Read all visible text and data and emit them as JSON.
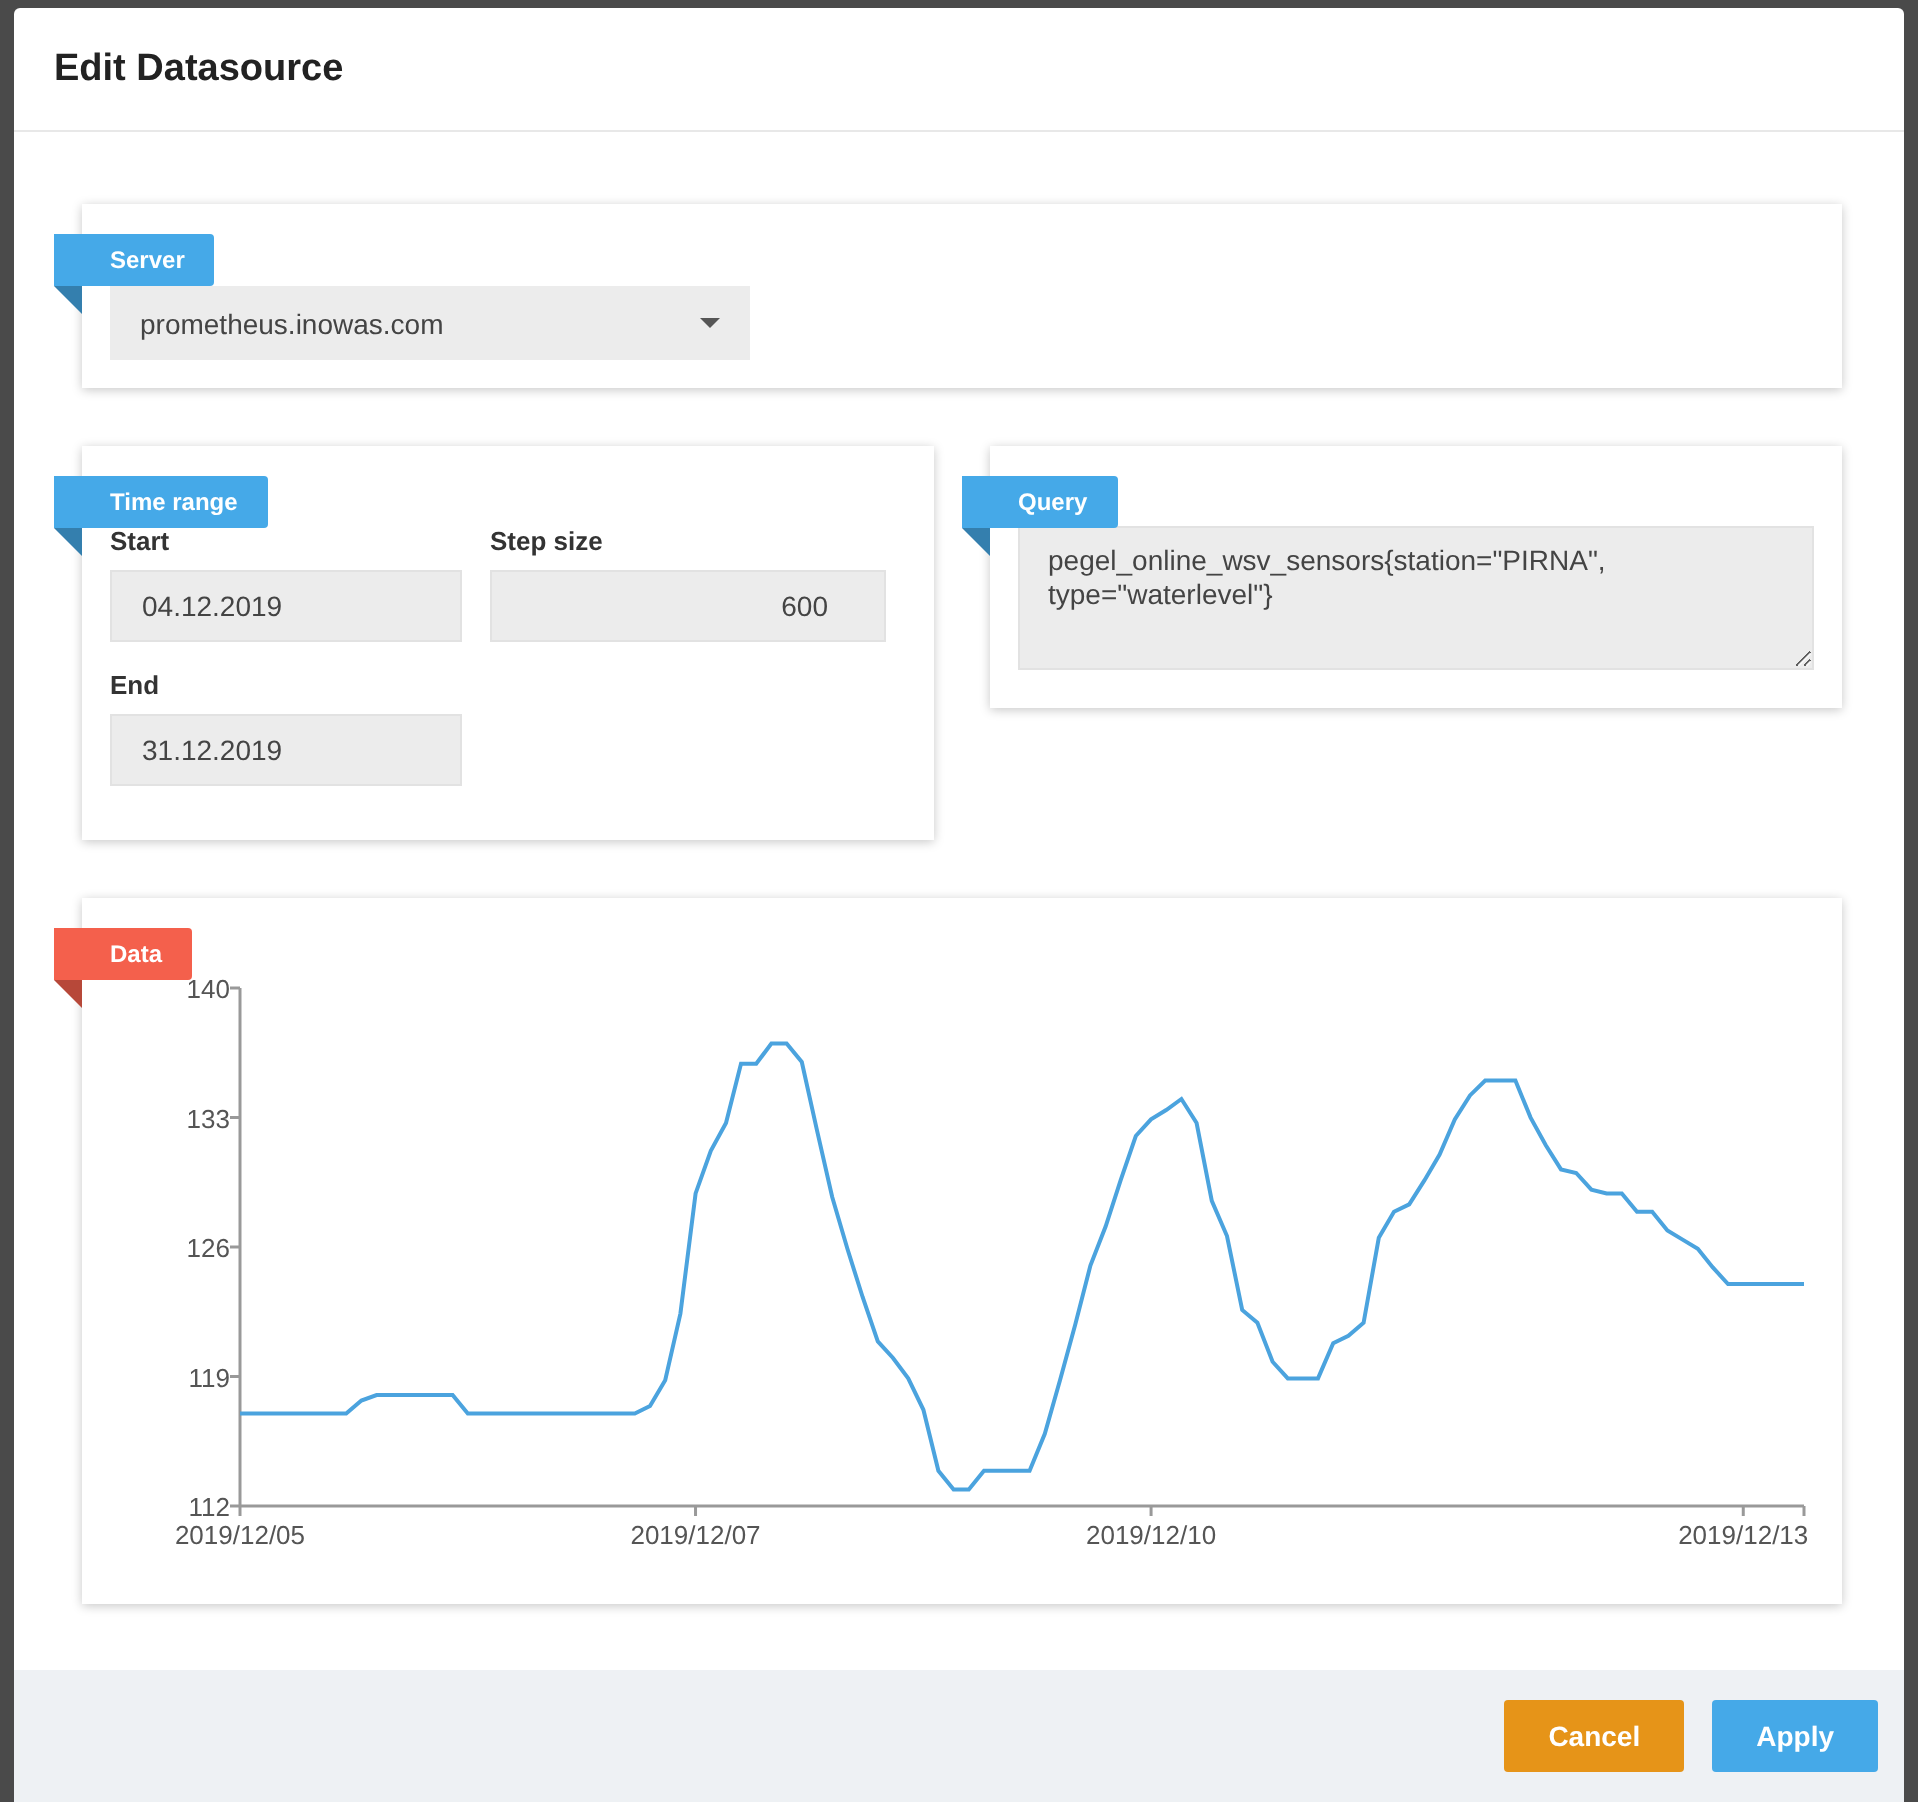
{
  "dialog": {
    "title": "Edit Datasource"
  },
  "server": {
    "label": "Server",
    "color": "#45a9e8",
    "value": "prometheus.inowas.com"
  },
  "time_range": {
    "label": "Time range",
    "color": "#45a9e8",
    "fields": [
      {
        "label": "Start",
        "value": "04.12.2019",
        "kind": "text"
      },
      {
        "label": "Step size",
        "value": "600",
        "kind": "number"
      },
      {
        "label": "End",
        "value": "31.12.2019",
        "kind": "text"
      }
    ]
  },
  "query": {
    "label": "Query",
    "color": "#45a9e8",
    "value": "pegel_online_wsv_sensors{station=\"PIRNA\", type=\"waterlevel\"}"
  },
  "data": {
    "label": "Data",
    "color": "#f4604c",
    "chart_data": {
      "type": "line",
      "ylim": [
        112,
        140
      ],
      "yticks": [
        112,
        119,
        126,
        133,
        140
      ],
      "categories": [
        "2019/12/05",
        null,
        null,
        null,
        null,
        null,
        null,
        null,
        null,
        null,
        null,
        null,
        null,
        null,
        null,
        null,
        null,
        null,
        null,
        null,
        null,
        null,
        null,
        null,
        null,
        null,
        null,
        null,
        null,
        null,
        "2019/12/07",
        null,
        null,
        null,
        null,
        null,
        null,
        null,
        null,
        null,
        null,
        null,
        null,
        null,
        null,
        null,
        null,
        null,
        null,
        null,
        null,
        null,
        null,
        null,
        null,
        null,
        null,
        null,
        null,
        null,
        "2019/12/10",
        null,
        null,
        null,
        null,
        null,
        null,
        null,
        null,
        null,
        null,
        null,
        null,
        null,
        null,
        null,
        null,
        null,
        null,
        null,
        null,
        null,
        null,
        null,
        null,
        null,
        null,
        null,
        null,
        null,
        null,
        null,
        null,
        null,
        null,
        null,
        null,
        null,
        null,
        "2019/12/13",
        null,
        null,
        null,
        null
      ],
      "series": [
        {
          "color": "#4ba3de",
          "values": [
            117,
            117,
            117,
            117,
            117,
            117,
            117,
            117,
            117.7,
            118,
            118,
            118,
            118,
            118,
            118,
            117,
            117,
            117,
            117,
            117,
            117,
            117,
            117,
            117,
            117,
            117,
            117,
            117.4,
            118.8,
            122.4,
            128.9,
            131.2,
            132.7,
            135.9,
            135.9,
            137,
            137,
            136.0,
            132.3,
            128.7,
            125.9,
            123.3,
            120.9,
            120,
            118.9,
            117.2,
            113.9,
            112.9,
            112.9,
            113.9,
            113.9,
            113.9,
            113.9,
            115.9,
            118.8,
            121.8,
            125.0,
            127.1,
            129.6,
            132,
            132.9,
            133.4,
            134,
            132.7,
            128.5,
            126.6,
            122.6,
            121.9,
            119.8,
            118.9,
            118.9,
            118.9,
            120.8,
            121.2,
            121.9,
            126.5,
            127.9,
            128.3,
            129.6,
            131,
            132.9,
            134.2,
            135,
            135,
            135,
            133.0,
            131.5,
            130.2,
            130,
            129.1,
            128.9,
            128.9,
            127.9,
            127.9,
            126.9,
            126.4,
            125.9,
            124.9,
            124,
            124,
            124,
            124,
            124,
            124
          ]
        }
      ]
    }
  },
  "buttons": [
    {
      "label": "Cancel",
      "kind": "cancel"
    },
    {
      "label": "Apply",
      "kind": "primary"
    }
  ]
}
